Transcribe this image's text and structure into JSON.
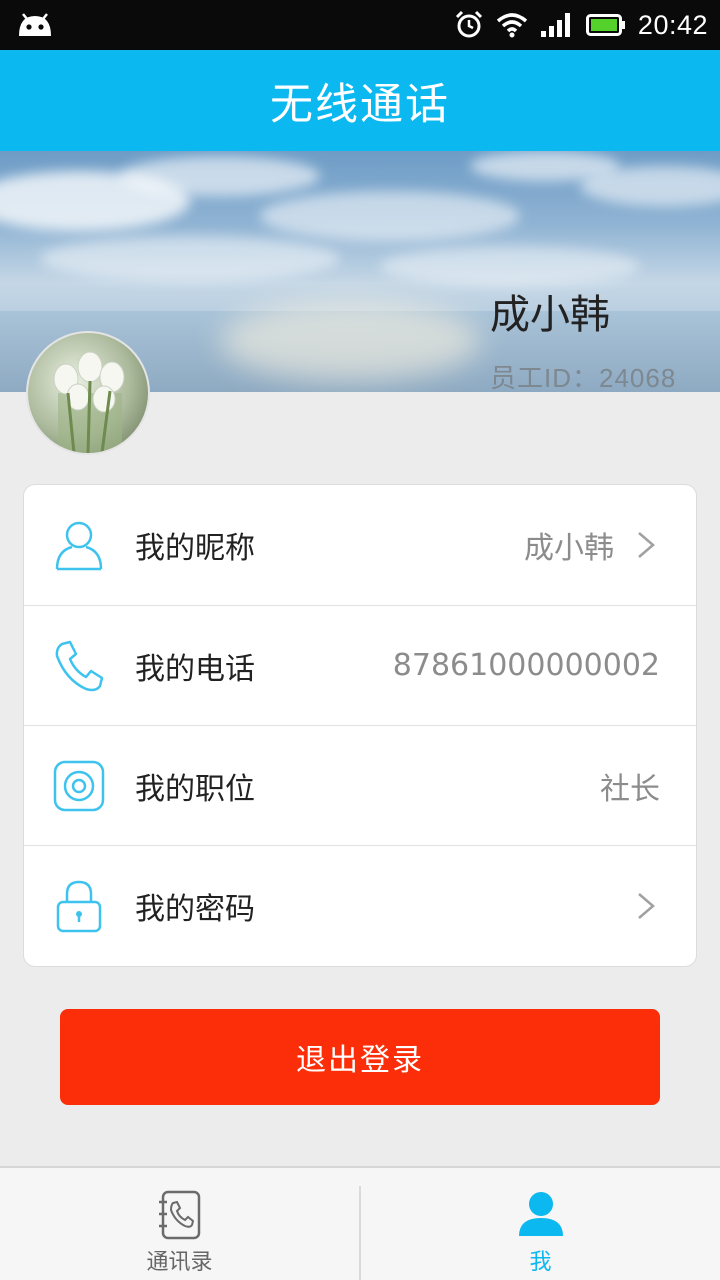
{
  "status_bar": {
    "time": "20:42"
  },
  "header": {
    "title": "无线通话"
  },
  "profile": {
    "name": "成小韩",
    "employee_id": "员工ID：24068"
  },
  "settings": [
    {
      "label": "我的昵称",
      "value": "成小韩",
      "icon": "user-icon",
      "has_arrow": true
    },
    {
      "label": "我的电话",
      "value": "87861000000002",
      "icon": "phone-icon",
      "has_arrow": false
    },
    {
      "label": "我的职位",
      "value": "社长",
      "icon": "position-icon",
      "has_arrow": false
    },
    {
      "label": "我的密码",
      "value": "",
      "icon": "lock-icon",
      "has_arrow": true
    }
  ],
  "logout": {
    "label": "退出登录"
  },
  "tabs": [
    {
      "label": "通讯录",
      "icon": "contacts-icon",
      "active": false
    },
    {
      "label": "我",
      "icon": "person-icon",
      "active": true
    }
  ],
  "colors": {
    "accent": "#0bb8ef",
    "danger": "#fc2e09",
    "tab_inactive": "#666666",
    "icon_line": "#3ec3ee"
  }
}
